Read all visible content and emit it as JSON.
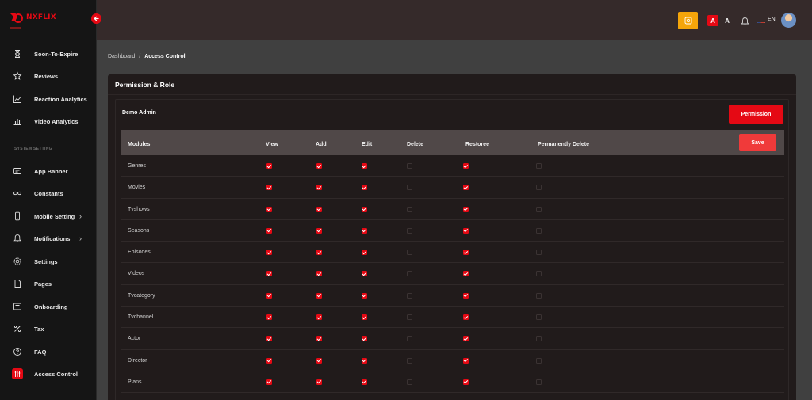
{
  "brand": {
    "name": "NXFLIX",
    "accent": "#e50914"
  },
  "sidebar": {
    "items_top": [
      {
        "label": "Soon-To-Expire",
        "icon": "hourglass-icon"
      },
      {
        "label": "Reviews",
        "icon": "star-icon"
      },
      {
        "label": "Reaction Analytics",
        "icon": "line-chart-icon"
      },
      {
        "label": "Video Analytics",
        "icon": "bar-chart-icon"
      }
    ],
    "section_label": "SYSTEM SETTING",
    "items": [
      {
        "label": "App Banner",
        "icon": "banner-icon"
      },
      {
        "label": "Constants",
        "icon": "infinity-icon"
      },
      {
        "label": "Mobile Setting",
        "icon": "mobile-icon",
        "has_children": true
      },
      {
        "label": "Notifications",
        "icon": "bell-icon",
        "has_children": true
      },
      {
        "label": "Settings",
        "icon": "gear-icon"
      },
      {
        "label": "Pages",
        "icon": "page-icon"
      },
      {
        "label": "Onboarding",
        "icon": "onboarding-icon"
      },
      {
        "label": "Tax",
        "icon": "percent-icon"
      },
      {
        "label": "FAQ",
        "icon": "question-icon"
      },
      {
        "label": "Access Control",
        "icon": "sliders-icon",
        "active": true
      }
    ]
  },
  "header": {
    "font_small": "A",
    "font_large": "A",
    "language": "EN"
  },
  "breadcrumb": {
    "root": "Dashboard",
    "separator": "/",
    "current": "Access Control"
  },
  "card": {
    "title": "Permission & Role",
    "role": "Demo Admin",
    "permission_button": "Permission",
    "save_button": "Save"
  },
  "table": {
    "columns": [
      "Modules",
      "View",
      "Add",
      "Edit",
      "Delete",
      "Restoree",
      "Permanently Delete"
    ],
    "rows": [
      {
        "module": "Genres",
        "perms": [
          true,
          true,
          true,
          false,
          true,
          false
        ]
      },
      {
        "module": "Movies",
        "perms": [
          true,
          true,
          true,
          false,
          true,
          false
        ]
      },
      {
        "module": "Tvshows",
        "perms": [
          true,
          true,
          true,
          false,
          true,
          false
        ]
      },
      {
        "module": "Seasons",
        "perms": [
          true,
          true,
          true,
          false,
          true,
          false
        ]
      },
      {
        "module": "Episodes",
        "perms": [
          true,
          true,
          true,
          false,
          true,
          false
        ]
      },
      {
        "module": "Videos",
        "perms": [
          true,
          true,
          true,
          false,
          true,
          false
        ]
      },
      {
        "module": "Tvcategory",
        "perms": [
          true,
          true,
          true,
          false,
          true,
          false
        ]
      },
      {
        "module": "Tvchannel",
        "perms": [
          true,
          true,
          true,
          false,
          true,
          false
        ]
      },
      {
        "module": "Actor",
        "perms": [
          true,
          true,
          true,
          false,
          true,
          false
        ]
      },
      {
        "module": "Director",
        "perms": [
          true,
          true,
          true,
          false,
          true,
          false
        ]
      },
      {
        "module": "Plans",
        "perms": [
          true,
          true,
          true,
          false,
          true,
          false
        ]
      },
      {
        "module": "",
        "perms": [
          true,
          true,
          true,
          false,
          true,
          false
        ]
      }
    ]
  }
}
